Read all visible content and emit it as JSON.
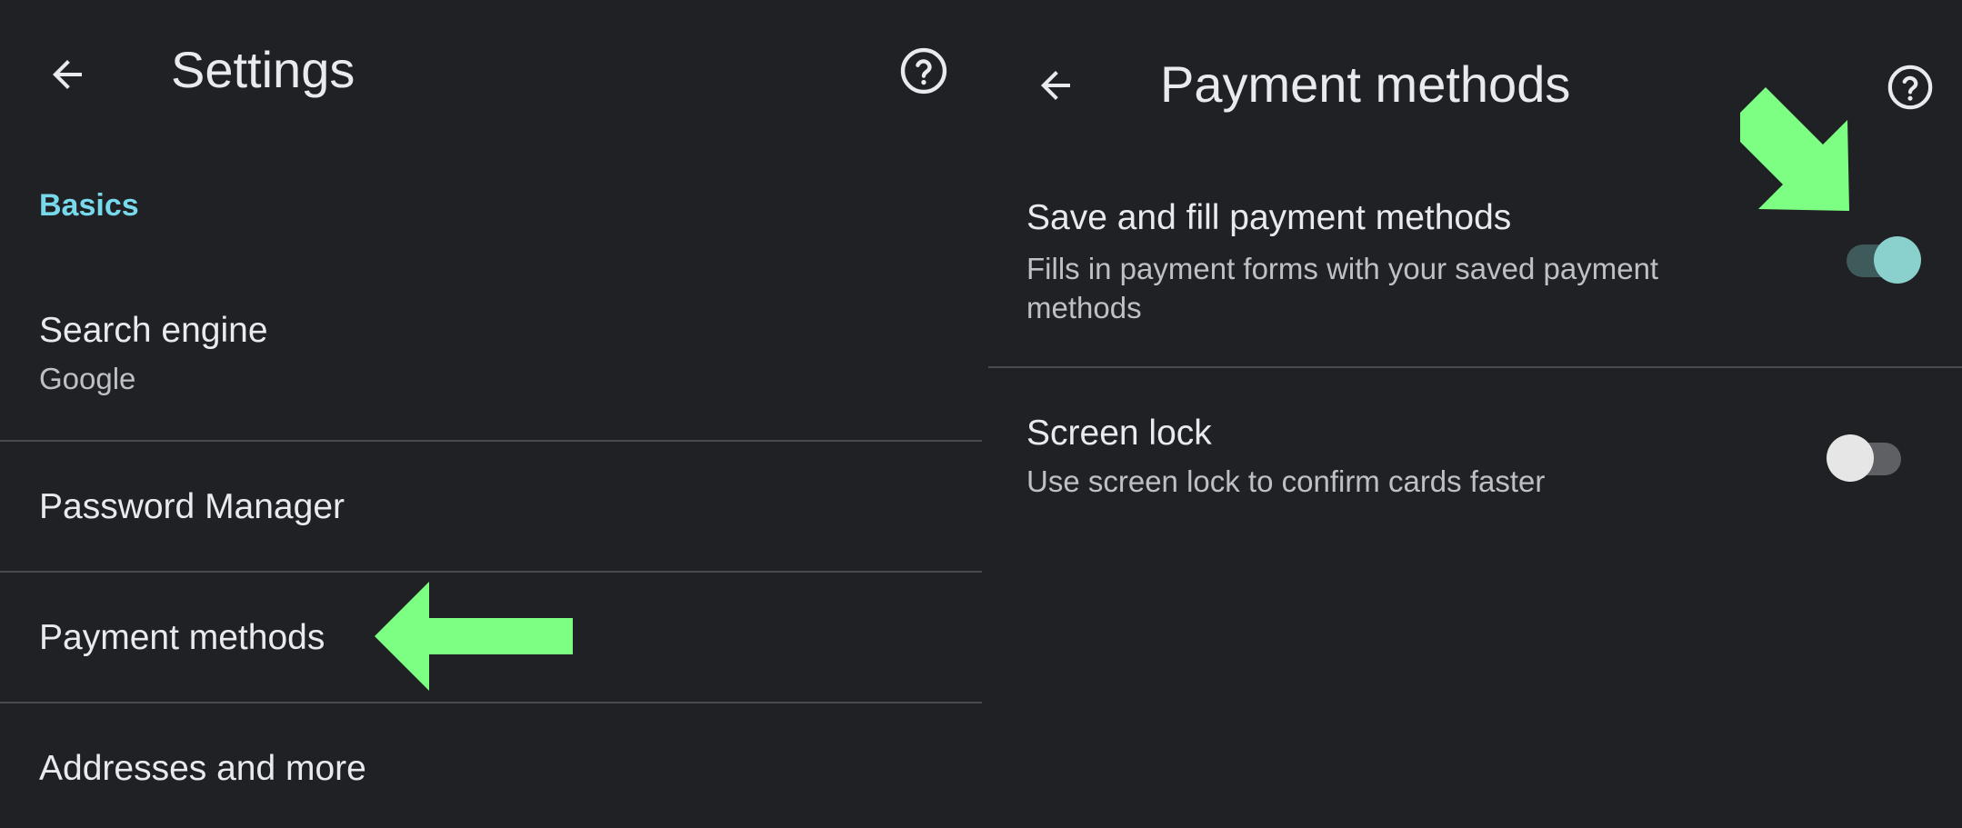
{
  "colors": {
    "background": "#202124",
    "accent": "#78d9ec",
    "text_primary": "#e8eaed",
    "text_secondary": "#bdc1c6",
    "divider": "#4a4b4f",
    "annotation_arrow": "#7dff84",
    "toggle_on_thumb": "#8ad0cc",
    "toggle_on_track": "#3e5a5a",
    "toggle_off_thumb": "#e6e6e6",
    "toggle_off_track": "#5f6063"
  },
  "settings": {
    "title": "Settings",
    "back_icon": "arrow-back-icon",
    "help_icon": "help-circle-icon",
    "section_basics": "Basics",
    "items": [
      {
        "title": "Search engine",
        "subtitle": "Google"
      },
      {
        "title": "Password Manager"
      },
      {
        "title": "Payment methods"
      },
      {
        "title": "Addresses and more"
      }
    ]
  },
  "payment_methods": {
    "title": "Payment methods",
    "back_icon": "arrow-back-icon",
    "help_icon": "help-circle-icon",
    "items": [
      {
        "title": "Save and fill payment methods",
        "subtitle": "Fills in payment forms with your saved payment methods",
        "toggle_on": true
      },
      {
        "title": "Screen lock",
        "subtitle": "Use screen lock to confirm cards faster",
        "toggle_on": false
      }
    ]
  },
  "annotations": {
    "left_arrow_icon": "arrow-left-annotation-icon",
    "right_arrow_icon": "arrow-down-right-annotation-icon"
  }
}
